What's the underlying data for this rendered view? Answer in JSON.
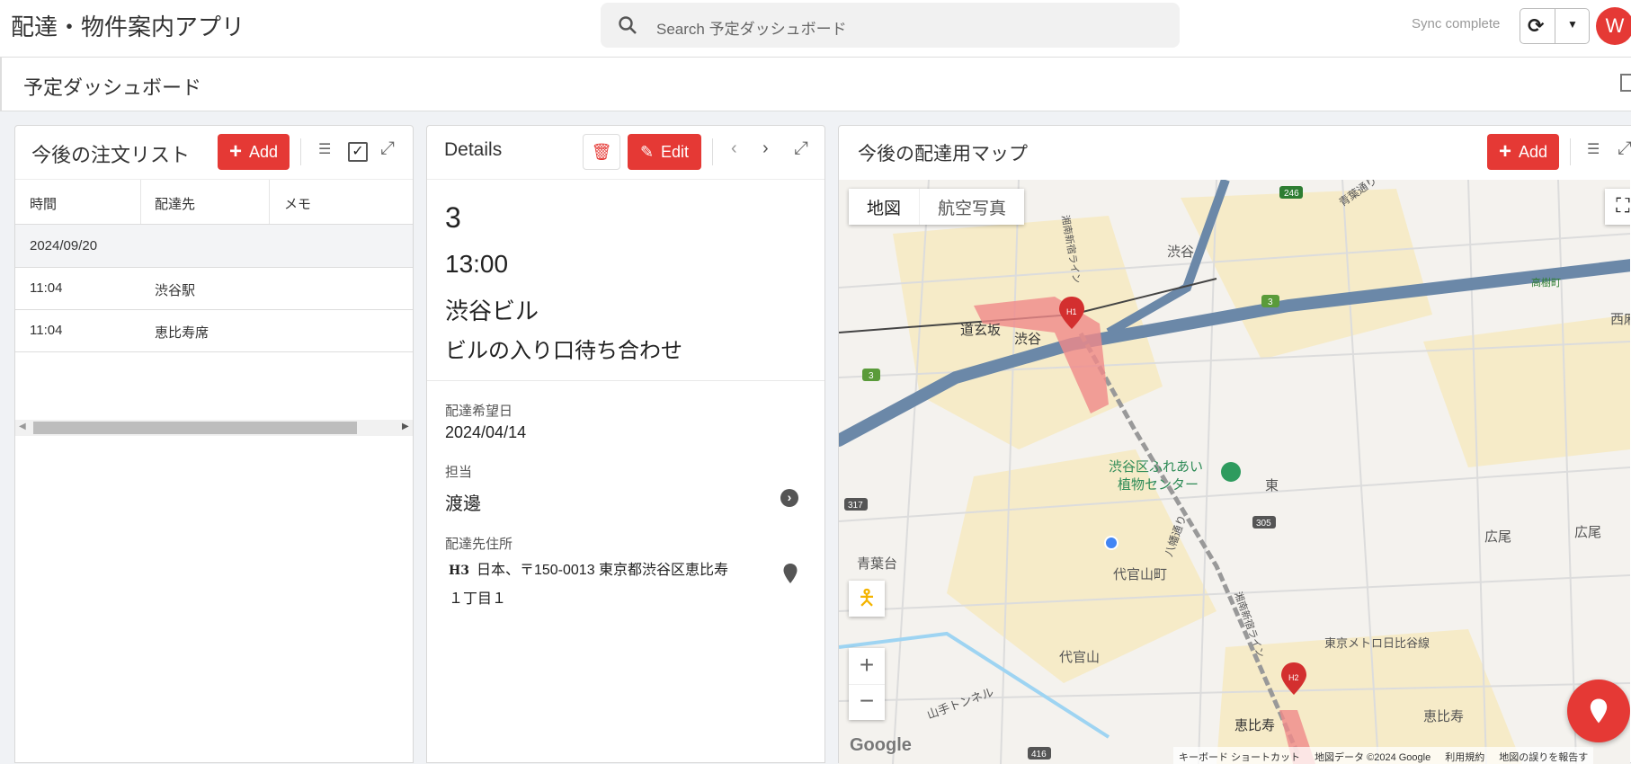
{
  "header": {
    "app_title": "配達・物件案内アプリ",
    "search_placeholder": "Search 予定ダッシュボード",
    "sync_status": "Sync complete",
    "avatar_initial": "W"
  },
  "dashboard": {
    "title": "予定ダッシュボード"
  },
  "order_list": {
    "title": "今後の注文リスト",
    "add_label": "Add",
    "columns": [
      "時間",
      "配達先",
      "メモ"
    ],
    "group": "2024/09/20",
    "rows": [
      {
        "time": "11:04",
        "dest": "渋谷駅",
        "memo": ""
      },
      {
        "time": "11:04",
        "dest": "恵比寿席",
        "memo": ""
      }
    ]
  },
  "details": {
    "title": "Details",
    "edit_label": "Edit",
    "id": "3",
    "time": "13:00",
    "place": "渋谷ビル",
    "note": "ビルの入り口待ち合わせ",
    "date_label": "配達希望日",
    "date": "2024/04/14",
    "assignee_label": "担当",
    "assignee": "渡邊",
    "address_label": "配達先住所",
    "address_tag": "H3",
    "address_line1": "日本、〒150-0013 東京都渋谷区恵比寿",
    "address_line2": "１丁目１"
  },
  "map_panel": {
    "title": "今後の配達用マップ",
    "add_label": "Add",
    "map_type_tabs": [
      "地図",
      "航空写真"
    ],
    "labels": {
      "shibuya": "渋谷",
      "dogenzaka": "道玄坂",
      "shibuya_st": "渋谷",
      "garden": "渋谷区ふれあい",
      "garden2": "植物センター",
      "daikanyamacho": "代官山町",
      "aobadai": "青葉台",
      "daikanyama": "代官山",
      "ebisu": "恵比寿",
      "ebisu2": "恵比寿",
      "hiroo": "広尾",
      "hiroo2": "広尾",
      "higashi": "東",
      "hibiya": "東京メトロ日比谷線",
      "nishiazabu": "西麻",
      "takagicho": "高樹町",
      "aoyama_dori": "青葉通り",
      "hachiman": "八幡通り",
      "shonan": "湘南新宿ライン",
      "yamate": "山手トンネル",
      "r246": "246",
      "r3a": "3",
      "r3b": "3",
      "r317": "317",
      "r305": "305",
      "r416": "416",
      "h1": "H1",
      "h2": "H2"
    },
    "attribution": {
      "keyboard": "キーボード ショートカット",
      "data": "地図データ ©2024 Google",
      "terms": "利用規約",
      "report": "地図の誤りを報告す"
    },
    "google_logo": "Google",
    "colors": {
      "accent": "#e53935",
      "highway": "#6b88a8",
      "park": "#cde8c8",
      "area": "#f6ebc8"
    }
  }
}
